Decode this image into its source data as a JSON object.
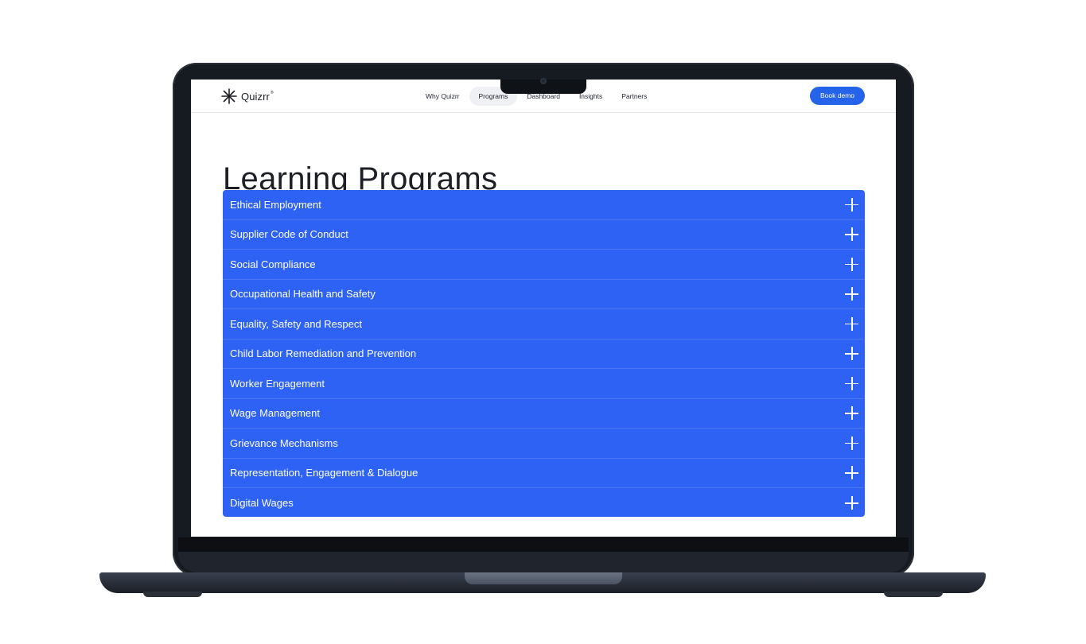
{
  "brand": {
    "name": "Quizrr",
    "reg": "®"
  },
  "nav": {
    "links": [
      {
        "label": "Why Quizrr",
        "active": false
      },
      {
        "label": "Programs",
        "active": true
      },
      {
        "label": "Dashboard",
        "active": false
      },
      {
        "label": "Insights",
        "active": false
      },
      {
        "label": "Partners",
        "active": false
      }
    ],
    "cta": "Book demo"
  },
  "page": {
    "title": "Learning Programs",
    "programs": [
      "Ethical Employment",
      "Supplier Code of Conduct",
      "Social Compliance",
      "Occupational Health and Safety",
      "Equality, Safety and Respect",
      "Child Labor Remediation and Prevention",
      "Worker Engagement",
      "Wage Management",
      "Grievance Mechanisms",
      "Representation, Engagement & Dialogue",
      "Digital Wages"
    ]
  },
  "colors": {
    "accent": "#2e62f5",
    "cta": "#2563eb",
    "device": "#161a21"
  },
  "icons": {
    "logo": "asterisk-star-icon",
    "expand": "plus-icon"
  }
}
